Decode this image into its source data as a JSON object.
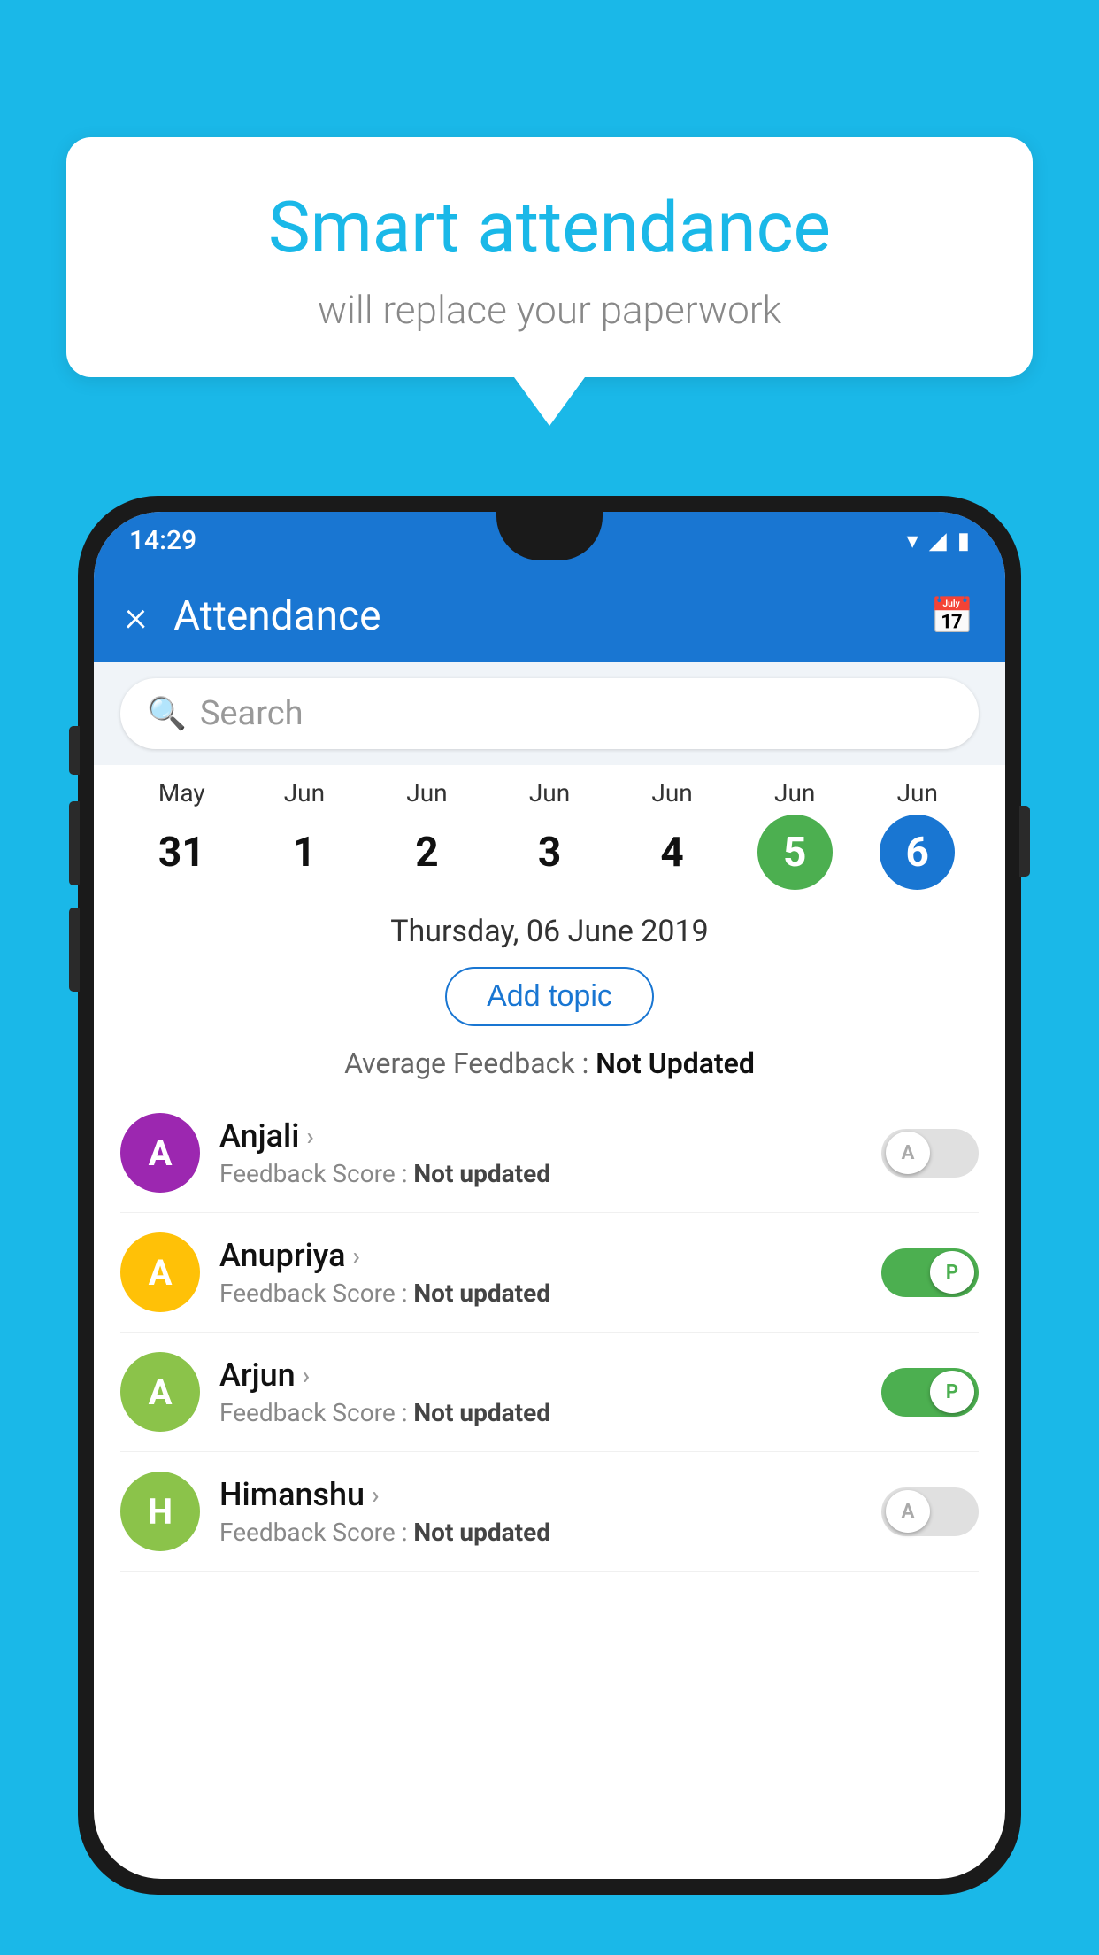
{
  "background_color": "#1ab8e8",
  "speech_bubble": {
    "title": "Smart attendance",
    "subtitle": "will replace your paperwork"
  },
  "status_bar": {
    "time": "14:29",
    "icons": [
      "wifi",
      "signal",
      "battery"
    ]
  },
  "app_bar": {
    "title": "Attendance",
    "close_label": "×",
    "calendar_icon": "📅"
  },
  "search": {
    "placeholder": "Search"
  },
  "calendar": {
    "days": [
      {
        "month": "May",
        "day": "31",
        "state": "normal"
      },
      {
        "month": "Jun",
        "day": "1",
        "state": "normal"
      },
      {
        "month": "Jun",
        "day": "2",
        "state": "normal"
      },
      {
        "month": "Jun",
        "day": "3",
        "state": "normal"
      },
      {
        "month": "Jun",
        "day": "4",
        "state": "normal"
      },
      {
        "month": "Jun",
        "day": "5",
        "state": "today"
      },
      {
        "month": "Jun",
        "day": "6",
        "state": "selected"
      }
    ]
  },
  "selected_date": "Thursday, 06 June 2019",
  "add_topic_label": "Add topic",
  "average_feedback": {
    "label": "Average Feedback : ",
    "value": "Not Updated"
  },
  "students": [
    {
      "name": "Anjali",
      "initial": "A",
      "avatar_color": "#9c27b0",
      "feedback_label": "Feedback Score : ",
      "feedback_value": "Not updated",
      "toggle_state": "off",
      "toggle_letter": "A"
    },
    {
      "name": "Anupriya",
      "initial": "A",
      "avatar_color": "#ffc107",
      "feedback_label": "Feedback Score : ",
      "feedback_value": "Not updated",
      "toggle_state": "on",
      "toggle_letter": "P"
    },
    {
      "name": "Arjun",
      "initial": "A",
      "avatar_color": "#8bc34a",
      "feedback_label": "Feedback Score : ",
      "feedback_value": "Not updated",
      "toggle_state": "on",
      "toggle_letter": "P"
    },
    {
      "name": "Himanshu",
      "initial": "H",
      "avatar_color": "#8bc34a",
      "feedback_label": "Feedback Score : ",
      "feedback_value": "Not updated",
      "toggle_state": "off",
      "toggle_letter": "A"
    }
  ]
}
